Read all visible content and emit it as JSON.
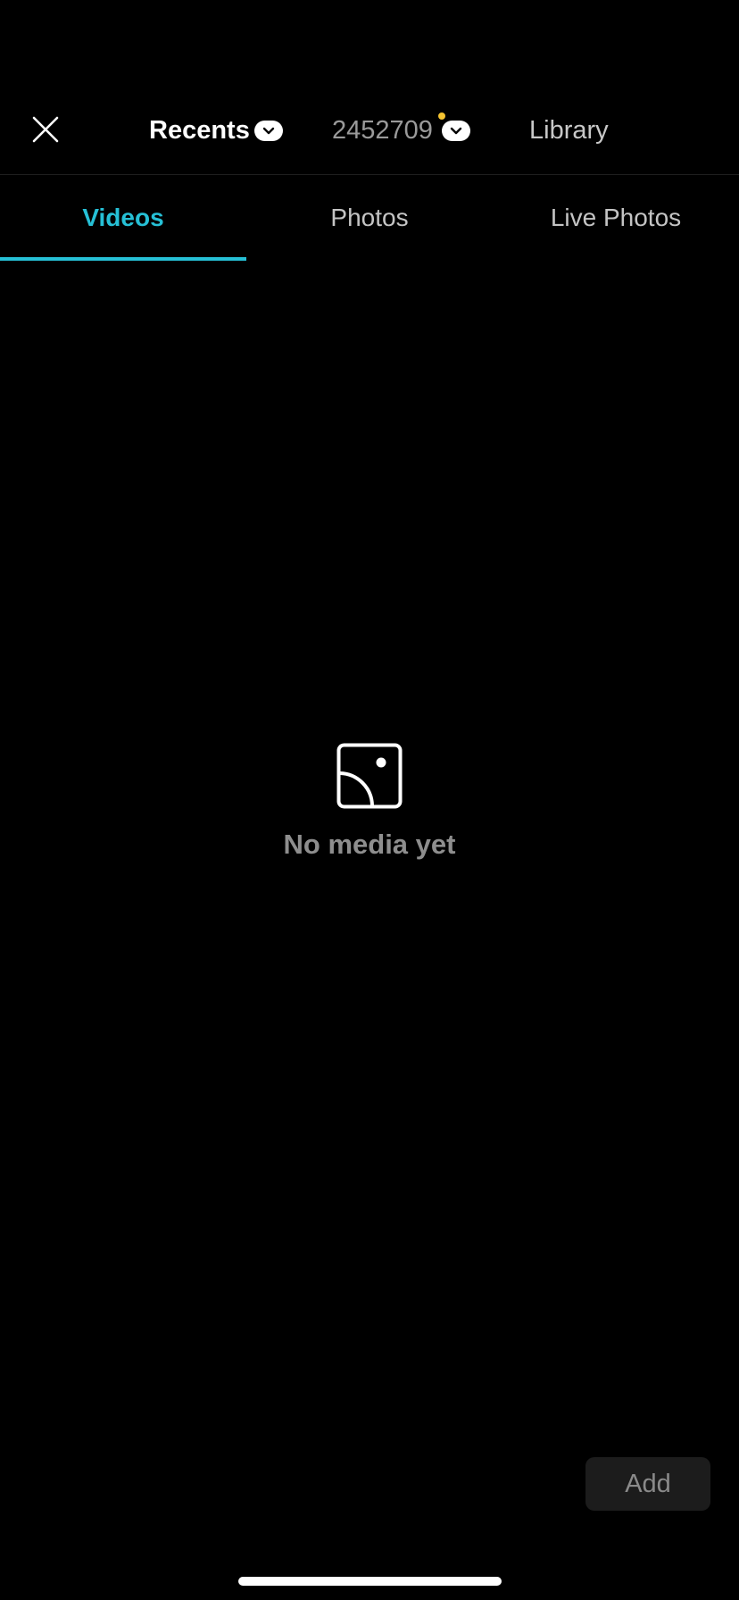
{
  "header": {
    "close_icon": "close-icon",
    "sources": [
      {
        "label": "Recents",
        "icon": "chevron-down-icon",
        "active": true
      },
      {
        "label": "2452709",
        "icon": "chevron-down-icon",
        "active": false,
        "indicator_color": "#f5c431"
      },
      {
        "label": "Library",
        "active": false
      }
    ]
  },
  "tabs": [
    {
      "label": "Videos",
      "active": true
    },
    {
      "label": "Photos",
      "active": false
    },
    {
      "label": "Live Photos",
      "active": false
    }
  ],
  "empty_state": {
    "icon": "image-placeholder-icon",
    "message": "No media yet"
  },
  "footer": {
    "add_label": "Add"
  },
  "colors": {
    "background": "#000000",
    "accent": "#26c0d6",
    "indicator": "#f5c431",
    "muted_text": "#8e8e8e"
  }
}
